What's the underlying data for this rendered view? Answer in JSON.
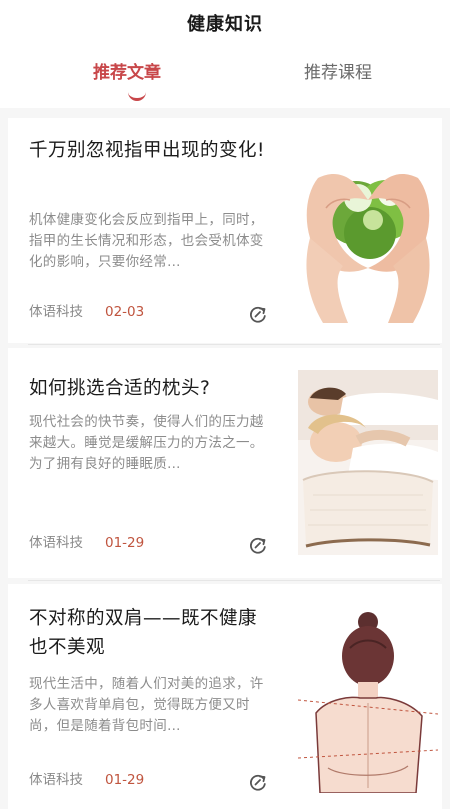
{
  "header": {
    "title": "健康知识"
  },
  "tabs": [
    {
      "label": "推荐文章",
      "active": true
    },
    {
      "label": "推荐课程",
      "active": false
    }
  ],
  "colors": {
    "accent": "#c8474a",
    "date": "#c0553f",
    "muted": "#8c8c8c"
  },
  "articles": [
    {
      "title": "千万别忽视指甲出现的变化!",
      "summary": "机体健康变化会反应到指甲上，同时，指甲的生长情况和形态，也会受机体变化的影响，只要你经常…",
      "source": "体语科技",
      "date": "02-03",
      "image": "hands-heart-leaves-image",
      "icon": "share-icon"
    },
    {
      "title": "如何挑选合适的枕头?",
      "summary": "现代社会的快节奏，使得人们的压力越来越大。睡觉是缓解压力的方法之一。为了拥有良好的睡眠质…",
      "source": "体语科技",
      "date": "01-29",
      "image": "sleeping-pillow-image",
      "icon": "share-icon"
    },
    {
      "title": "不对称的双肩——既不健康也不美观",
      "summary": "现代生活中，随着人们对美的追求，许多人喜欢背单肩包，觉得既方便又时尚，但是随着背包时间…",
      "source": "体语科技",
      "date": "01-29",
      "image": "shoulders-illustration-image",
      "icon": "share-icon"
    }
  ]
}
